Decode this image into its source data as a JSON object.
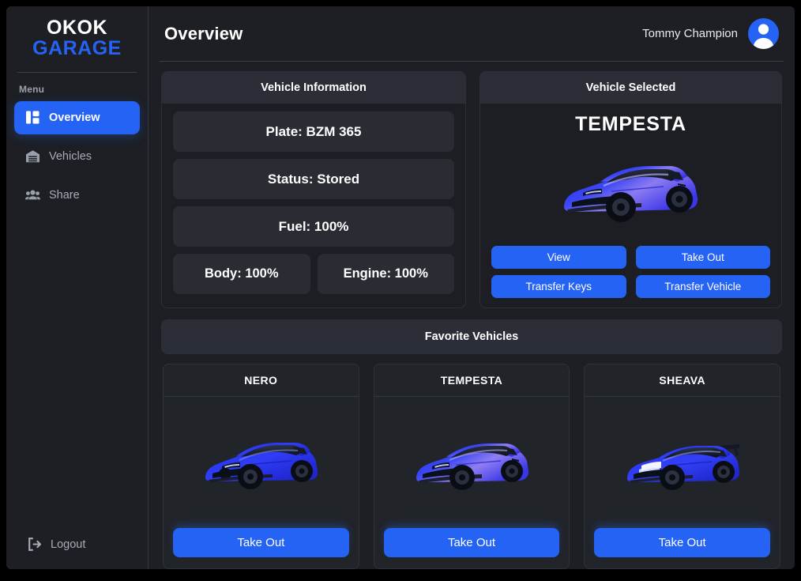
{
  "brand": {
    "line1": "OKOK",
    "line2": "GARAGE"
  },
  "sidebar": {
    "menu_label": "Menu",
    "items": [
      {
        "label": "Overview",
        "icon": "dashboard-icon",
        "active": true
      },
      {
        "label": "Vehicles",
        "icon": "garage-icon",
        "active": false
      },
      {
        "label": "Share",
        "icon": "people-icon",
        "active": false
      }
    ],
    "logout": {
      "label": "Logout",
      "icon": "logout-icon"
    }
  },
  "header": {
    "title": "Overview",
    "user_name": "Tommy Champion",
    "avatar_icon": "user-avatar-icon"
  },
  "vehicle_information": {
    "title": "Vehicle Information",
    "rows": [
      "Plate: BZM 365",
      "Status: Stored",
      "Fuel: 100%"
    ],
    "pair": [
      "Body: 100%",
      "Engine: 100%"
    ]
  },
  "vehicle_selected": {
    "title": "Vehicle Selected",
    "name": "TEMPESTA",
    "car_image": "blue-sports-car",
    "buttons": [
      "View",
      "Take Out",
      "Transfer Keys",
      "Transfer Vehicle"
    ]
  },
  "favorites": {
    "title": "Favorite Vehicles",
    "cards": [
      {
        "name": "NERO",
        "button": "Take Out",
        "car_image": "blue-coupe-car"
      },
      {
        "name": "TEMPESTA",
        "button": "Take Out",
        "car_image": "blue-sports-car"
      },
      {
        "name": "SHEAVA",
        "button": "Take Out",
        "car_image": "blue-supercar"
      }
    ]
  },
  "colors": {
    "accent": "#2563f5",
    "panel_bg": "#1c1e24",
    "panel_head_bg": "#2b2e36",
    "tile_bg": "#292c33",
    "app_bg": "#1d1f25",
    "text": "#ffffff",
    "muted_text": "#a8acb6"
  }
}
